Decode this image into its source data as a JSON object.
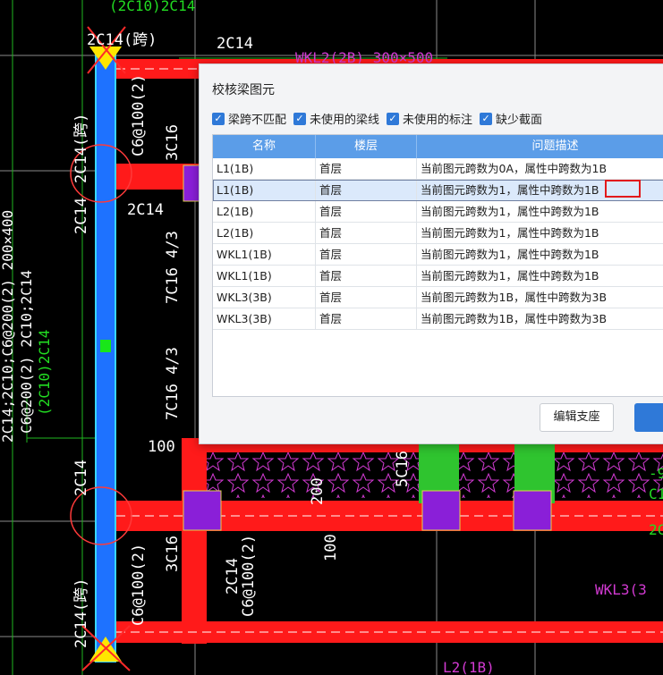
{
  "cad": {
    "labels": {
      "top_cut": "(2C10)2C14",
      "left_top_beam": "2C14(跨)",
      "top_2c14": "2C14",
      "wkl_top": "WKL2(2B) 300×500",
      "col_left_upper": "2C14(跨)",
      "col_c6_upper": "C6@100(2)",
      "col_3c16_upper": "3C16",
      "mid_2c14_v": "2C14",
      "mid_2c14_h": "2C14",
      "seven_c16_upper": "7C16 4/3",
      "seven_c16_lower": "7C16 4/3",
      "left_big_1": "2C14;2C10;C6@200(2) 200×400",
      "left_big_2": "C6@200(2) 2C10;2C14",
      "left_big_3": "(2C10)2C14",
      "num_100_upper": "100",
      "lower_2c14": "2C14",
      "lower_3c16": "3C16",
      "lower_c6": "C6@100(2)",
      "lower_2c14_left": "2C14(跨)",
      "lower_mid_2c14": "2C14",
      "lower_mid_c6": "C6@100(2)",
      "num_200": "200",
      "num_100_lower": "100",
      "five_c16": "5C16",
      "wkl3_right": "WKL3(3",
      "bottom_l2": "L2(1B)",
      "right_frag_1": "-9",
      "right_frag_2": "C1",
      "right_frag_3": "2C"
    }
  },
  "dialog": {
    "title": "校核梁图元",
    "filters": [
      {
        "label": "梁跨不匹配",
        "checked": true
      },
      {
        "label": "未使用的梁线",
        "checked": true
      },
      {
        "label": "未使用的标注",
        "checked": true
      },
      {
        "label": "缺少截面",
        "checked": true
      }
    ],
    "columns": [
      "名称",
      "楼层",
      "问题描述"
    ],
    "rows": [
      {
        "name": "L1(1B)",
        "floor": "首层",
        "desc": "当前图元跨数为0A，属性中跨数为1B"
      },
      {
        "name": "L1(1B)",
        "floor": "首层",
        "desc": "当前图元跨数为1，属性中跨数为1B"
      },
      {
        "name": "L2(1B)",
        "floor": "首层",
        "desc": "当前图元跨数为1，属性中跨数为1B"
      },
      {
        "name": "L2(1B)",
        "floor": "首层",
        "desc": "当前图元跨数为1，属性中跨数为1B"
      },
      {
        "name": "WKL1(1B)",
        "floor": "首层",
        "desc": "当前图元跨数为1，属性中跨数为1B"
      },
      {
        "name": "WKL1(1B)",
        "floor": "首层",
        "desc": "当前图元跨数为1，属性中跨数为1B"
      },
      {
        "name": "WKL3(3B)",
        "floor": "首层",
        "desc": "当前图元跨数为1B，属性中跨数为3B"
      },
      {
        "name": "WKL3(3B)",
        "floor": "首层",
        "desc": "当前图元跨数为1B，属性中跨数为3B"
      }
    ],
    "selected_row": 1,
    "buttons": {
      "edit_support": "编辑支座"
    }
  }
}
